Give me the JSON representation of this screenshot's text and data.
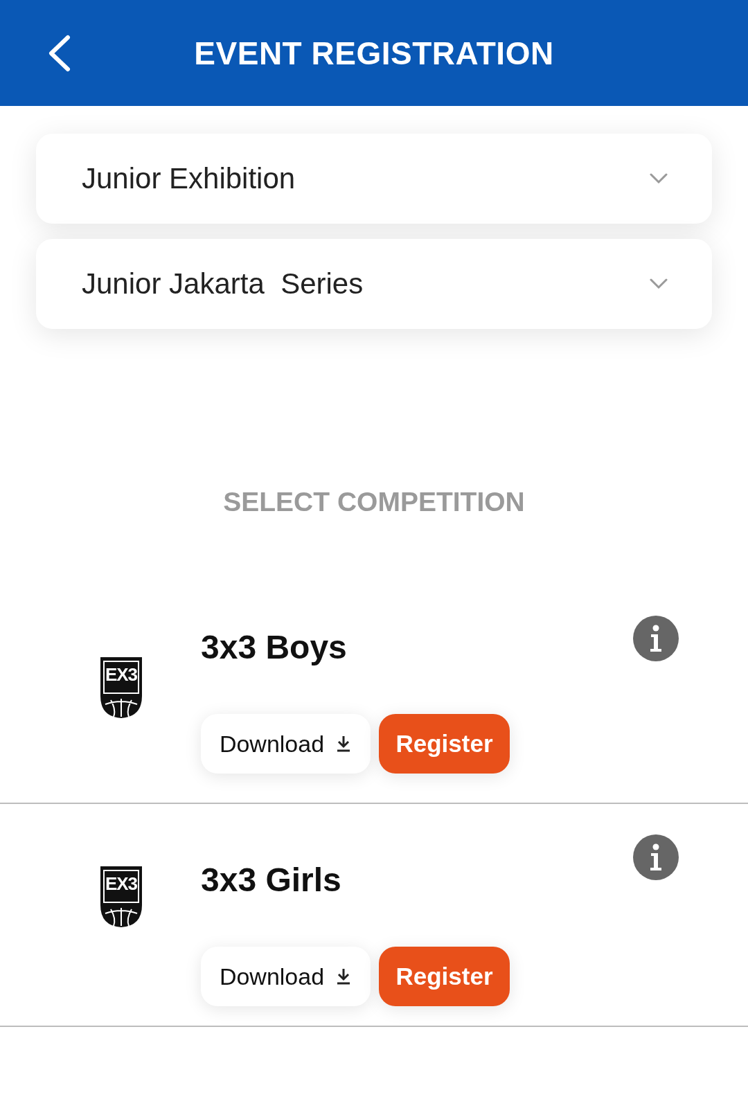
{
  "header": {
    "title": "EVENT REGISTRATION"
  },
  "events": [
    {
      "name": "Junior Exhibition",
      "expanded": false
    },
    {
      "name": "Junior Jakarta  Series",
      "expanded": false
    }
  ],
  "section_title": "SELECT COMPETITION",
  "competitions": [
    {
      "logo_text": "EX3",
      "name": "3x3 Boys",
      "download": "Download",
      "register": "Register"
    },
    {
      "logo_text": "EX3",
      "name": "3x3 Girls",
      "download": "Download",
      "register": "Register"
    }
  ]
}
